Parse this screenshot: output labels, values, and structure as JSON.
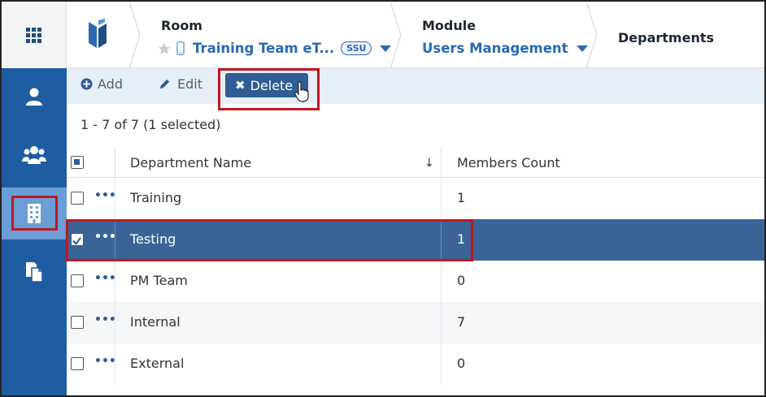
{
  "header": {
    "room": {
      "label": "Room",
      "value": "Training Team eT...",
      "badge": "SSU"
    },
    "module": {
      "label": "Module",
      "value": "Users Management"
    },
    "page": {
      "label": "Departments"
    }
  },
  "sidebar": {
    "items": [
      {
        "icon": "user-icon"
      },
      {
        "icon": "users-group-icon"
      },
      {
        "icon": "building-icon",
        "active": true
      },
      {
        "icon": "documents-icon"
      }
    ]
  },
  "toolbar": {
    "add_label": "Add",
    "edit_label": "Edit",
    "delete_label": "Delete"
  },
  "list": {
    "count_text": "1 - 7 of 7 (1 selected)",
    "columns": {
      "name": "Department Name",
      "sort_indicator": "↓",
      "members": "Members Count"
    },
    "row_menu_glyph": "•••",
    "rows": [
      {
        "name": "Training",
        "members": "1",
        "selected": false
      },
      {
        "name": "Testing",
        "members": "1",
        "selected": true
      },
      {
        "name": "PM Team",
        "members": "0",
        "selected": false
      },
      {
        "name": "Internal",
        "members": "7",
        "selected": false
      },
      {
        "name": "External",
        "members": "0",
        "selected": false
      }
    ]
  },
  "colors": {
    "sidebar": "#1f5da3",
    "selected_row": "#3a6498",
    "accent_text": "#2a6ab0",
    "highlight_box": "#c0181e"
  }
}
